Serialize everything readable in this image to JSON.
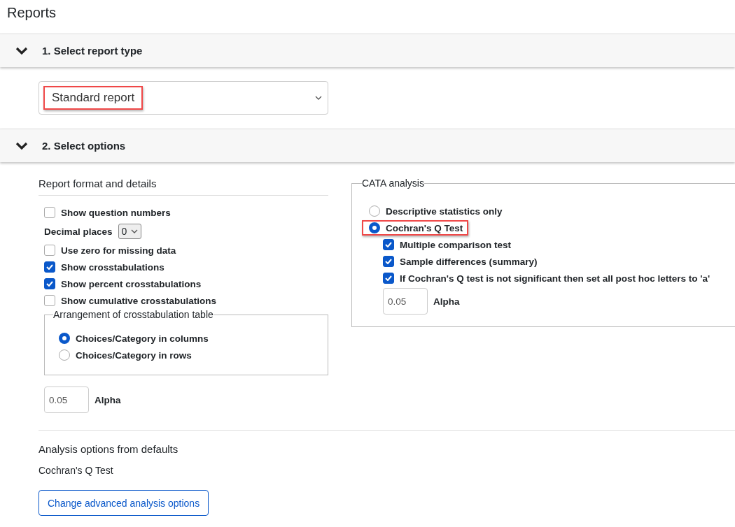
{
  "page_title": "Reports",
  "sections": [
    {
      "title": "1. Select report type",
      "expanded": true,
      "kind": "report_type",
      "select": {
        "value": "Standard report",
        "highlighted": true
      }
    },
    {
      "title": "2. Select options",
      "expanded": true,
      "kind": "options",
      "format": {
        "heading": "Report format and details",
        "items": [
          {
            "kind": "checkbox",
            "label": "Show question numbers",
            "checked": false
          },
          {
            "kind": "select",
            "label": "Decimal places",
            "value": "0"
          },
          {
            "kind": "checkbox",
            "label": "Use zero for missing data",
            "checked": false
          },
          {
            "kind": "checkbox",
            "label": "Show crosstabulations",
            "checked": true
          },
          {
            "kind": "checkbox",
            "label": "Show percent crosstabulations",
            "checked": true
          },
          {
            "kind": "checkbox",
            "label": "Show cumulative crosstabulations",
            "checked": false
          }
        ],
        "arrangement": {
          "legend": "Arrangement of crosstabulation table",
          "options": [
            {
              "label": "Choices/Category in columns",
              "selected": true
            },
            {
              "label": "Choices/Category in rows",
              "selected": false
            }
          ]
        },
        "alpha": {
          "value": "0.05",
          "label": "Alpha"
        }
      },
      "cata": {
        "legend": "CATA analysis",
        "options": [
          {
            "label": "Descriptive statistics only",
            "selected": false,
            "highlighted": false
          },
          {
            "label": "Cochran's Q Test",
            "selected": true,
            "highlighted": true
          }
        ],
        "sub_options": [
          {
            "label": "Multiple comparison test",
            "checked": true
          },
          {
            "label": "Sample differences (summary)",
            "checked": true
          },
          {
            "label": "If Cochran's Q test is not significant then set all post hoc letters to 'a'",
            "checked": true
          }
        ],
        "alpha": {
          "value": "0.05",
          "label": "Alpha"
        }
      },
      "defaults": {
        "heading": "Analysis options from defaults",
        "text": "Cochran's Q Test",
        "button": "Change advanced analysis options"
      }
    }
  ]
}
